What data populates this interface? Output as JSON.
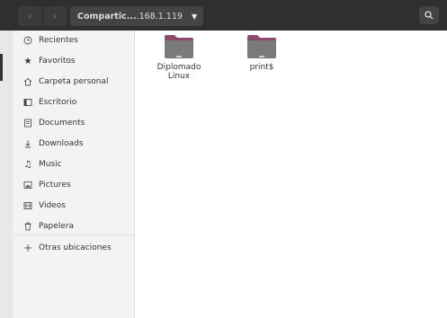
{
  "header": {
    "back_icon": "chevron-left-icon",
    "forward_icon": "chevron-right-icon",
    "path_main": "Compartic...",
    "path_sub": ".168.1.119",
    "path_dropdown_icon": "caret-down-icon",
    "search_icon": "search-icon"
  },
  "sidebar": {
    "items": [
      {
        "label": "Recientes",
        "icon": "clock-icon"
      },
      {
        "label": "Favoritos",
        "icon": "star-icon"
      },
      {
        "label": "Carpeta personal",
        "icon": "home-icon"
      },
      {
        "label": "Escritorio",
        "icon": "desktop-icon"
      },
      {
        "label": "Documents",
        "icon": "document-icon"
      },
      {
        "label": "Downloads",
        "icon": "download-icon"
      },
      {
        "label": "Music",
        "icon": "music-icon"
      },
      {
        "label": "Pictures",
        "icon": "picture-icon"
      },
      {
        "label": "Videos",
        "icon": "video-icon"
      },
      {
        "label": "Papelera",
        "icon": "trash-icon"
      }
    ],
    "other_locations": {
      "label": "Otras ubicaciones",
      "icon": "plus-icon"
    }
  },
  "content": {
    "files": [
      {
        "name_line1": "Diplomado",
        "name_line2": "Linux",
        "icon": "folder-icon"
      },
      {
        "name_line1": "print$",
        "name_line2": "",
        "icon": "folder-icon"
      }
    ]
  },
  "colors": {
    "headerbar": "#2f2f2f",
    "folder_body": "#7a7a7a",
    "folder_tab": "#8e4a6a"
  }
}
